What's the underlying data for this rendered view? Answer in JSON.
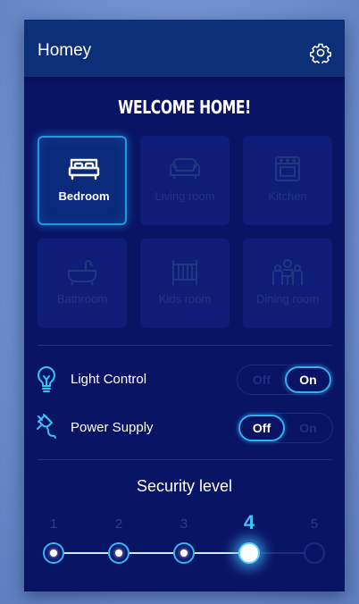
{
  "app": {
    "title": "Homey",
    "settings_icon": "gear-icon"
  },
  "welcome": "WELCOME HOME!",
  "rooms": [
    {
      "label": "Bedroom",
      "icon": "bed-icon",
      "selected": true
    },
    {
      "label": "Living room",
      "icon": "sofa-icon",
      "selected": false
    },
    {
      "label": "Kitchen",
      "icon": "oven-icon",
      "selected": false
    },
    {
      "label": "Bathroom",
      "icon": "bathtub-icon",
      "selected": false
    },
    {
      "label": "Kids room",
      "icon": "crib-icon",
      "selected": false
    },
    {
      "label": "Dining room",
      "icon": "dining-table-icon",
      "selected": false
    }
  ],
  "controls": [
    {
      "label": "Light Control",
      "icon": "lightbulb-icon",
      "off_label": "Off",
      "on_label": "On",
      "state": "On"
    },
    {
      "label": "Power Supply",
      "icon": "power-plug-icon",
      "off_label": "Off",
      "on_label": "On",
      "state": "Off"
    }
  ],
  "security": {
    "title": "Security level",
    "levels": [
      "1",
      "2",
      "3",
      "4",
      "5"
    ],
    "current": "4"
  },
  "colors": {
    "accent": "#2fb3f0",
    "panel": "#0a1465",
    "appbar": "#0d2f78",
    "background": "#7594d0"
  }
}
